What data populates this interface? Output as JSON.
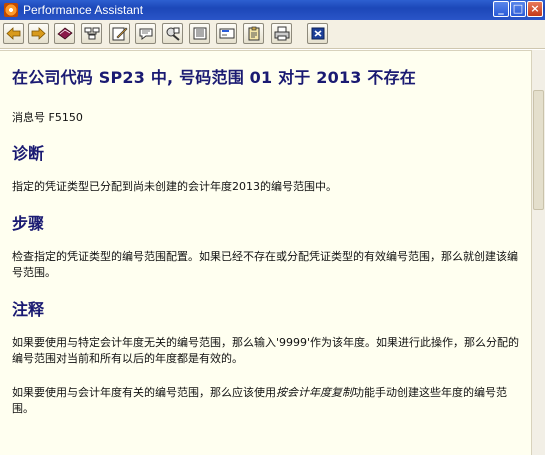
{
  "window": {
    "title": "Performance Assistant",
    "controls": [
      "minimize-icon",
      "maximize-icon",
      "close-icon"
    ]
  },
  "toolbar": {
    "buttons": [
      {
        "name": "back-button",
        "icon": "arrow-left-icon"
      },
      {
        "name": "forward-button",
        "icon": "arrow-right-icon"
      },
      {
        "name": "technical-info-button",
        "icon": "book-icon"
      },
      {
        "name": "structure-button",
        "icon": "tree-icon"
      },
      {
        "name": "edit-button",
        "icon": "pencil-icon"
      },
      {
        "name": "note-button",
        "icon": "note-icon"
      },
      {
        "name": "settings-button",
        "icon": "tools-icon"
      },
      {
        "name": "glossary-button",
        "icon": "book-open-icon"
      },
      {
        "name": "insert-button",
        "icon": "insert-icon"
      },
      {
        "name": "clipboard-button",
        "icon": "clipboard-icon"
      },
      {
        "name": "print-button",
        "icon": "printer-icon"
      },
      {
        "name": "close-button",
        "icon": "close-x-icon"
      }
    ]
  },
  "document": {
    "title": "在公司代码  SP23 中, 号码范围  01 对于  2013 不存在",
    "message_no": "消息号 F5150",
    "sections": [
      {
        "heading": "诊断",
        "paragraphs": [
          "指定的凭证类型已分配到尚未创建的会计年度2013的编号范围中。"
        ]
      },
      {
        "heading": "步骤",
        "paragraphs": [
          "检查指定的凭证类型的编号范围配置。如果已经不存在或分配凭证类型的有效编号范围，那么就创建该编号范围。"
        ]
      },
      {
        "heading": "注释",
        "paragraphs": [
          "如果要使用与特定会计年度无关的编号范围，那么输入'9999'作为该年度。如果进行此操作，那么分配的编号范围对当前和所有以后的年度都是有效的。"
        ]
      }
    ],
    "note_para2": {
      "before": "如果要使用与会计年度有关的编号范围，那么应该使用",
      "link": "按会计年度复制",
      "after": "功能手动创建这些年度的编号范围。"
    }
  },
  "colors": {
    "titlebar": "#1c47b8",
    "toolbar": "#f4f0e3",
    "content_bg": "#fffff0",
    "heading": "#1a1a72"
  }
}
